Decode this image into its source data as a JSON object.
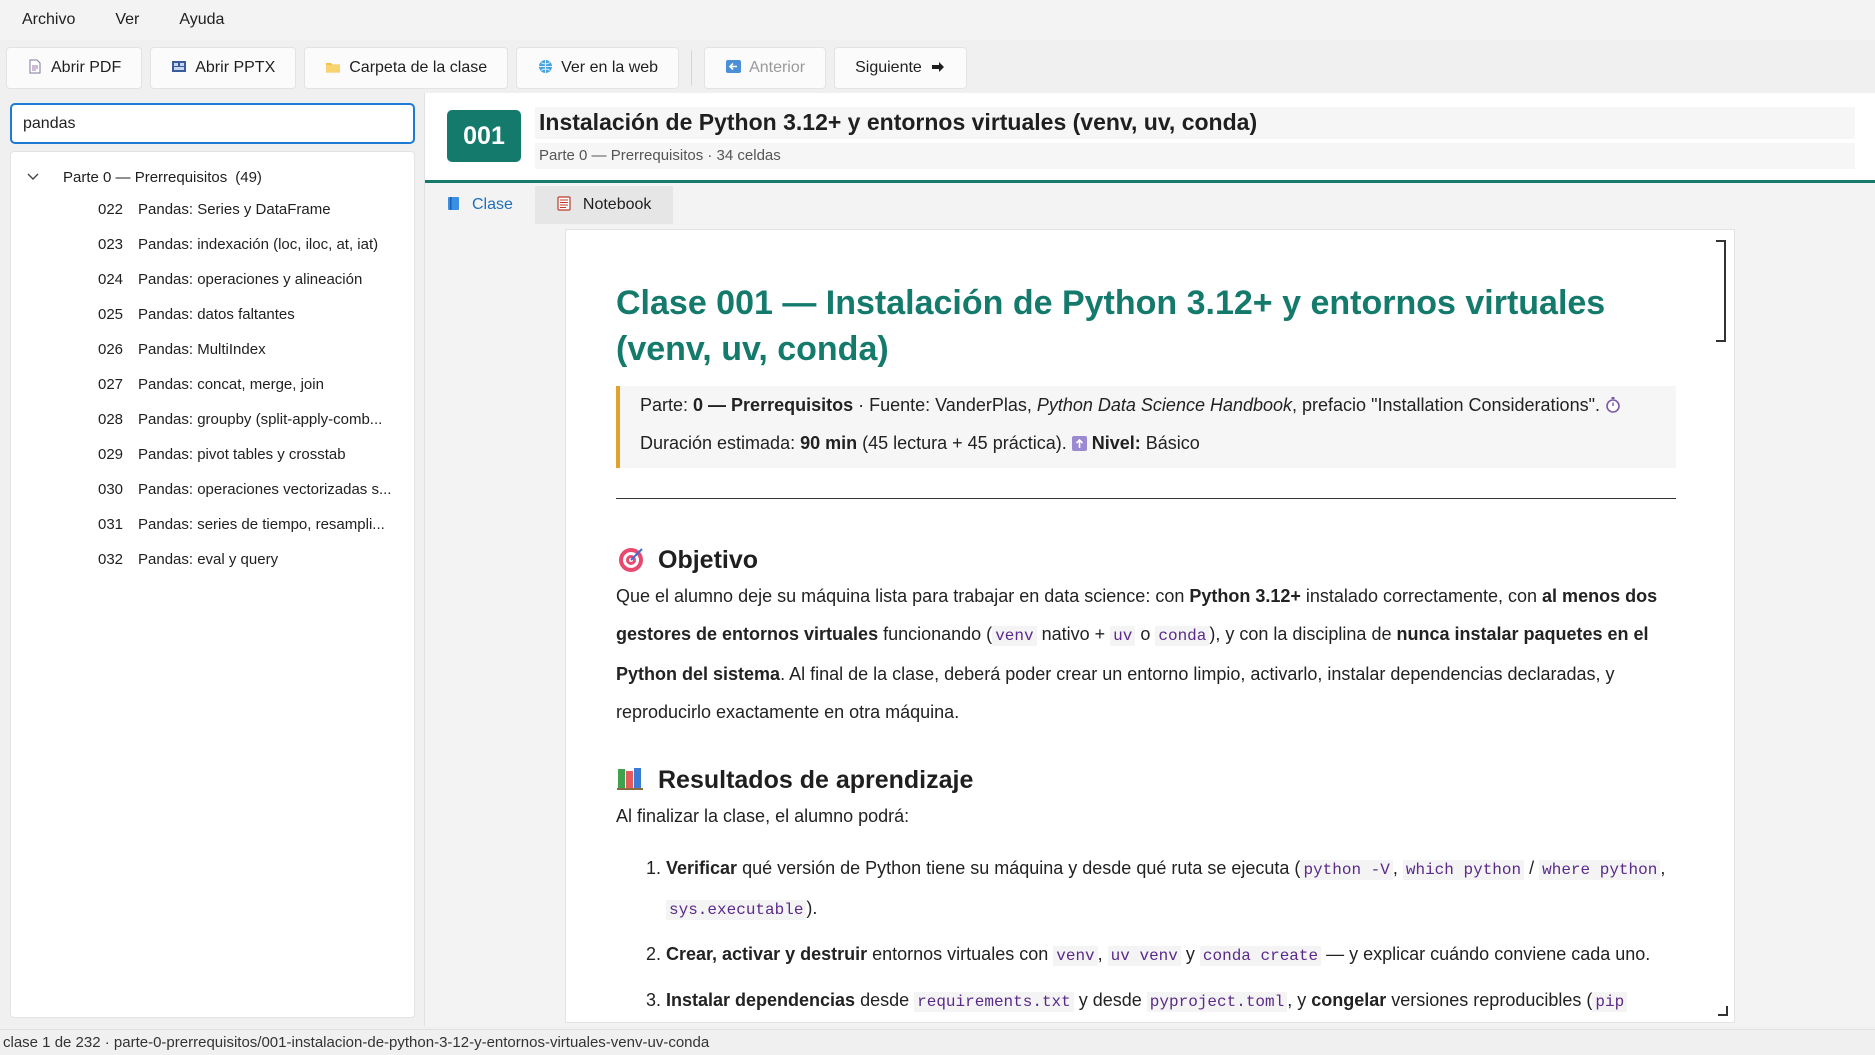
{
  "menubar": {
    "items": [
      "Archivo",
      "Ver",
      "Ayuda"
    ]
  },
  "toolbar": {
    "buttons": [
      {
        "label": "Abrir PDF",
        "icon": "pdf-file-icon"
      },
      {
        "label": "Abrir PPTX",
        "icon": "presentation-icon"
      },
      {
        "label": "Carpeta de la clase",
        "icon": "folder-icon"
      },
      {
        "label": "Ver en la web",
        "icon": "globe-icon"
      },
      {
        "label": "Anterior",
        "icon": "arrow-left-icon",
        "disabled": true
      },
      {
        "label": "Siguiente",
        "icon": "arrow-right-icon"
      }
    ]
  },
  "search": {
    "value": "pandas"
  },
  "tree": {
    "parent": {
      "label": "Parte 0 — Prerrequisitos",
      "count": "(49)"
    },
    "children": [
      {
        "num": "022",
        "title": "Pandas: Series y DataFrame"
      },
      {
        "num": "023",
        "title": "Pandas: indexación (loc, iloc, at, iat)"
      },
      {
        "num": "024",
        "title": "Pandas: operaciones y alineación"
      },
      {
        "num": "025",
        "title": "Pandas: datos faltantes"
      },
      {
        "num": "026",
        "title": "Pandas: MultiIndex"
      },
      {
        "num": "027",
        "title": "Pandas: concat, merge, join"
      },
      {
        "num": "028",
        "title": "Pandas: groupby (split-apply-comb..."
      },
      {
        "num": "029",
        "title": "Pandas: pivot tables y crosstab"
      },
      {
        "num": "030",
        "title": "Pandas: operaciones vectorizadas s..."
      },
      {
        "num": "031",
        "title": "Pandas: series de tiempo, resampli..."
      },
      {
        "num": "032",
        "title": "Pandas: eval y query"
      }
    ]
  },
  "header": {
    "badge": "001",
    "title": "Instalación de Python 3.12+ y entornos virtuales (venv, uv, conda)",
    "subtitle": "Parte 0 — Prerrequisitos · 34 celdas"
  },
  "tabs": [
    {
      "label": "Clase",
      "icon": "book-icon",
      "active": true
    },
    {
      "label": "Notebook",
      "icon": "notebook-icon",
      "active": false
    }
  ],
  "doc": {
    "title": "Clase 001 — Instalación de Python 3.12+ y entornos virtuales (venv, uv, conda)",
    "meta": {
      "parte_label": "Parte: ",
      "parte_value": "0 — Prerrequisitos",
      "fuente_prefix": " · Fuente: VanderPlas, ",
      "fuente_book": "Python Data Science Handbook",
      "fuente_suffix": ", prefacio \"Installation Considerations\". ",
      "duracion_label": "Duración estimada: ",
      "duracion_value": "90 min",
      "duracion_detail": " (45 lectura + 45 práctica). ",
      "nivel_label": "Nivel:",
      "nivel_value": " Básico"
    },
    "objetivo": {
      "heading": "Objetivo",
      "t1": "Que el alumno deje su máquina lista para trabajar en data science: con ",
      "b1": "Python 3.12+",
      "t2": " instalado correctamente, con ",
      "b2": "al menos dos gestores de entornos virtuales",
      "t3": " funcionando (",
      "c1": "venv",
      "t4": " nativo + ",
      "c2": "uv",
      "t5": " o ",
      "c3": "conda",
      "t6": "), y con la disciplina de ",
      "b3": "nunca instalar paquetes en el Python del sistema",
      "t7": ". Al final de la clase, deberá poder crear un entorno limpio, activarlo, instalar dependencias declaradas, y reproducirlo exactamente en otra máquina."
    },
    "resultados": {
      "heading": "Resultados de aprendizaje",
      "intro": "Al finalizar la clase, el alumno podrá:",
      "i1_b": "Verificar",
      "i1_t1": " qué versión de Python tiene su máquina y desde qué ruta se ejecuta (",
      "i1_c1": "python -V",
      "i1_t2": ", ",
      "i1_c2": "which python",
      "i1_t3": " / ",
      "i1_c3": "where python",
      "i1_t4": ", ",
      "i1_c4": "sys.executable",
      "i1_t5": ").",
      "i2_b": "Crear, activar y destruir",
      "i2_t1": " entornos virtuales con ",
      "i2_c1": "venv",
      "i2_t2": ", ",
      "i2_c2": "uv venv",
      "i2_t3": " y ",
      "i2_c3": "conda create",
      "i2_t4": " — y explicar cuándo conviene cada uno.",
      "i3_b": "Instalar dependencias",
      "i3_t1": " desde ",
      "i3_c1": "requirements.txt",
      "i3_t2": " y desde ",
      "i3_c2": "pyproject.toml",
      "i3_t3": ", y ",
      "i3_b2": "congelar",
      "i3_t4": " versiones reproducibles (",
      "i3_c3": "pip"
    }
  },
  "statusbar": {
    "text": "clase 1 de 232  ·  parte-0-prerrequisitos/001-instalacion-de-python-3-12-y-entornos-virtuales-venv-uv-conda"
  },
  "colors": {
    "accent": "#147a6c",
    "tab_active": "#1f6fb8",
    "search_border": "#1f7ad6",
    "meta_bar": "#e0a42e"
  }
}
